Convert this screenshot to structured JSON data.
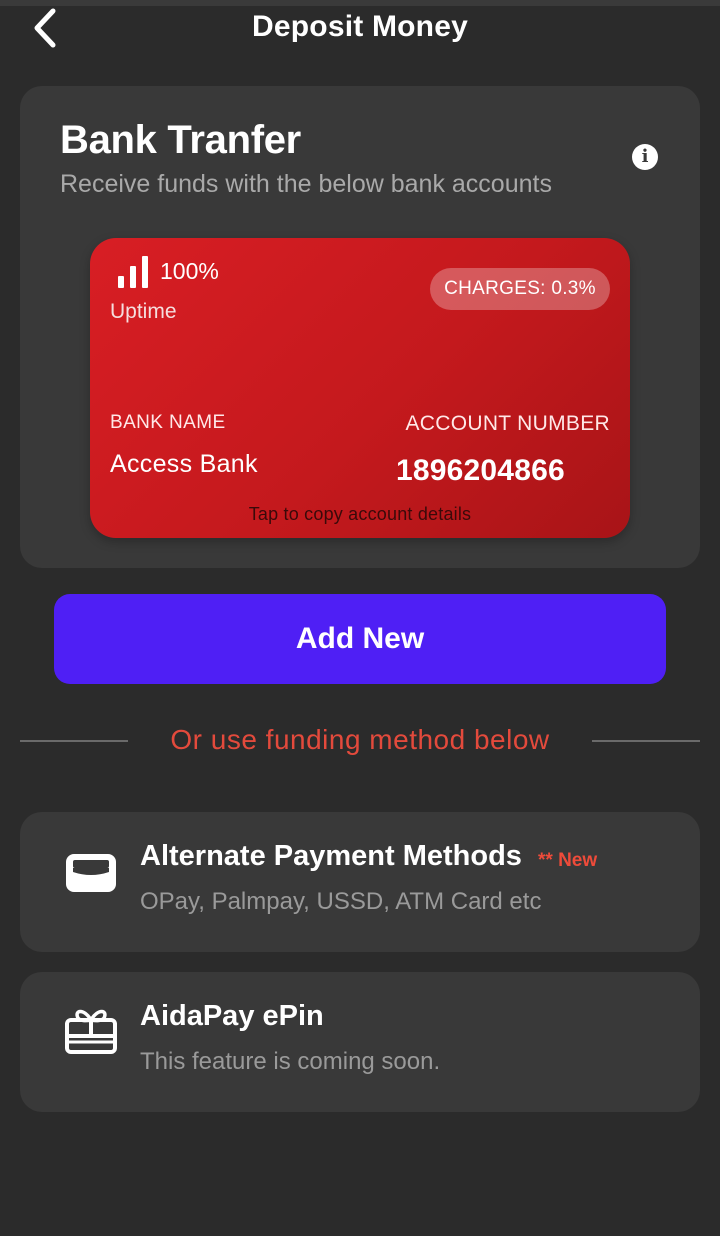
{
  "header": {
    "title": "Deposit Money"
  },
  "bank_transfer": {
    "title": "Bank Tranfer",
    "subtitle": "Receive funds with the below bank accounts",
    "card": {
      "uptime_value": "100%",
      "uptime_label": "Uptime",
      "charges": "CHARGES: 0.3%",
      "bank_name_label": "BANK NAME",
      "bank_name": "Access Bank",
      "account_number_label": "ACCOUNT NUMBER",
      "account_number": "1896204866",
      "copy_hint": "Tap to copy account details",
      "color": "#d81e24"
    }
  },
  "add_new_button": {
    "label": "Add New",
    "color": "#4f1ff5"
  },
  "divider": {
    "text": "Or use funding method below",
    "color": "#e34a3c"
  },
  "methods": [
    {
      "title": "Alternate Payment Methods",
      "badge": "** New",
      "subtitle": "OPay, Palmpay, USSD, ATM Card etc",
      "icon": "card-icon"
    },
    {
      "title": "AidaPay ePin",
      "subtitle": "This feature is coming soon.",
      "icon": "gift-icon"
    }
  ]
}
